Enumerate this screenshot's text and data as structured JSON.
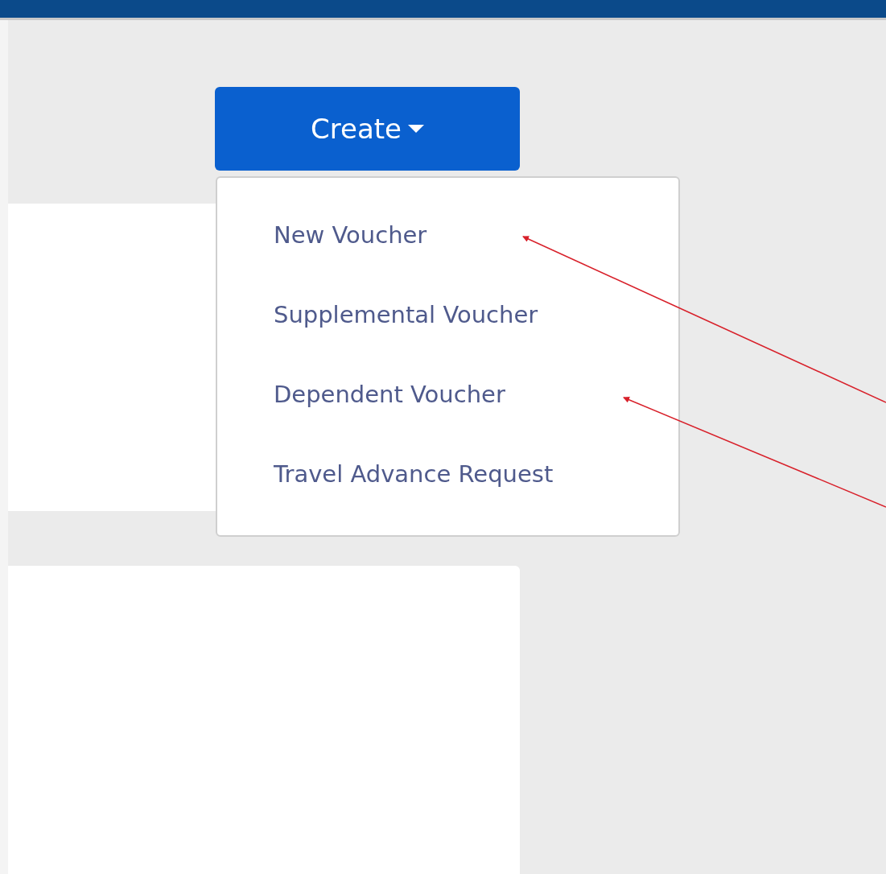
{
  "create_button": {
    "label": "Create"
  },
  "menu": {
    "expanded": true,
    "items": [
      {
        "label": "New Voucher"
      },
      {
        "label": "Supplemental Voucher"
      },
      {
        "label": "Dependent Voucher"
      },
      {
        "label": "Travel Advance Request"
      }
    ]
  },
  "annotations": [
    {
      "kind": "arrow"
    },
    {
      "kind": "arrow"
    }
  ]
}
